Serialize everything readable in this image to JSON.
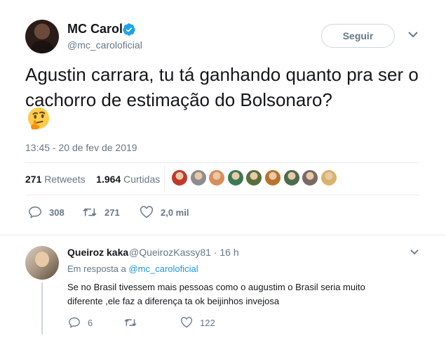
{
  "tweet": {
    "author_name": "MC Carol",
    "author_handle": "@mc_caroloficial",
    "follow_label": "Seguir",
    "text": "Agustin carrara, tu tá ganhando quanto pra ser o cachorro de estimação do Bolsonaro?",
    "emoji": "thinking-face-icon",
    "timestamp": "13:45 - 20 de fev de 2019",
    "retweets_count": "271",
    "retweets_label": "Retweets",
    "likes_count": "1.964",
    "likes_label": "Curtidas",
    "actions": {
      "replies": "308",
      "retweets": "271",
      "likes": "2,0 mil"
    },
    "likers_colors": [
      "#c0392b",
      "#8d8d8d",
      "#d98e5f",
      "#3b7a57",
      "#5a6f3c",
      "#b8732e",
      "#4d6b4e",
      "#7a6a66",
      "#d9b36c"
    ]
  },
  "reply": {
    "author_name": "Queiroz kaka",
    "author_handle_time": "@QueirozKassy81 · 16 h",
    "reply_prefix": "Em resposta a",
    "reply_to_handle": "@mc_caroloficial",
    "text": "Se no Brasil tivessem mais pessoas como o augustim o Brasil seria muito diferente ,ele faz a diferença ta ok beijinhos invejosa",
    "actions": {
      "replies": "6",
      "retweets": "",
      "likes": "122"
    }
  },
  "colors": {
    "verified": "#1da1f2",
    "link": "#1b95e0",
    "muted": "#657786"
  }
}
